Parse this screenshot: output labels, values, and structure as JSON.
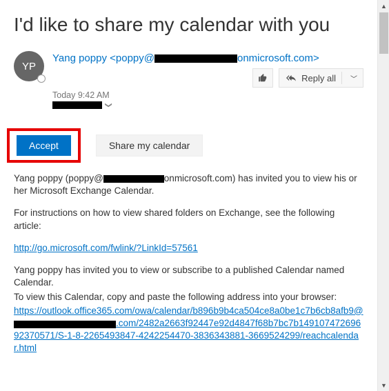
{
  "subject": "I'd like to share my calendar with you",
  "sender": {
    "initials": "YP",
    "display_prefix": "Yang poppy <poppy@",
    "display_suffix": "onmicrosoft.com>"
  },
  "actions": {
    "reply_all": "Reply all"
  },
  "meta": {
    "timestamp": "Today 9:42 AM"
  },
  "buttons": {
    "accept": "Accept",
    "share_my_calendar": "Share my calendar"
  },
  "body": {
    "p1_a": "Yang poppy (poppy@",
    "p1_b": "onmicrosoft.com) has invited you to view his or her Microsoft Exchange Calendar.",
    "p2": "For instructions on how to view shared folders on Exchange, see the following article:",
    "link1": "http://go.microsoft.com/fwlink/?LinkId=57561",
    "p3": "Yang poppy has invited you to view or subscribe to a published Calendar named Calendar.",
    "p4": "To view this Calendar, copy and paste the following address into your browser:",
    "link2_a": "https://outlook.office365.com/owa/calendar/b896b9b4ca504ce8a0be1c7b6cb8afb9@",
    "link2_b": ".com/2482a2663f92447e92d4847f68b7bc7b14910747269692370571/S-1-8-2265493847-4242254470-3836343881-3669524299/reachcalendar.html"
  }
}
